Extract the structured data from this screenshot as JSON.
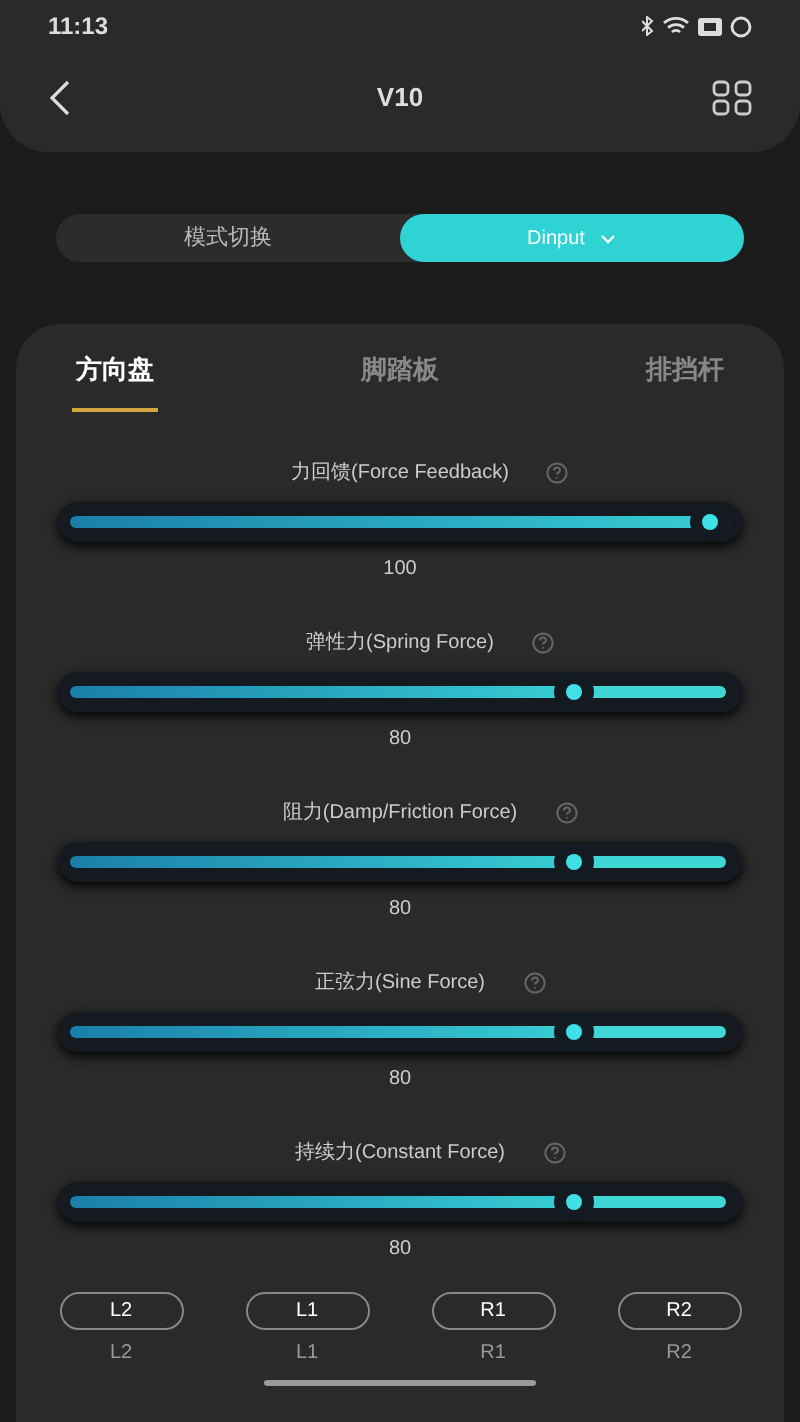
{
  "status_bar": {
    "time": "11:13"
  },
  "header": {
    "title": "V10"
  },
  "mode_switch": {
    "label": "模式切换",
    "value": "Dinput"
  },
  "tabs": [
    {
      "label": "方向盘",
      "selected": true
    },
    {
      "label": "脚踏板",
      "selected": false
    },
    {
      "label": "排挡杆",
      "selected": false
    }
  ],
  "sliders": [
    {
      "label": "力回馈(Force Feedback)",
      "level": 1.0,
      "reading": "100"
    },
    {
      "label": "弹性力(Spring Force)",
      "level": 0.78,
      "reading": "80"
    },
    {
      "label": "阻力(Damp/Friction Force)",
      "level": 0.78,
      "reading": "80"
    },
    {
      "label": "正弦力(Sine Force)",
      "level": 0.78,
      "reading": "80"
    },
    {
      "label": "持续力(Constant Force)",
      "level": 0.78,
      "reading": "80"
    }
  ],
  "buttons": [
    {
      "label": "L2",
      "caption": "L2"
    },
    {
      "label": "L1",
      "caption": "L1"
    },
    {
      "label": "R1",
      "caption": "R1"
    },
    {
      "label": "R2",
      "caption": "R2"
    }
  ]
}
